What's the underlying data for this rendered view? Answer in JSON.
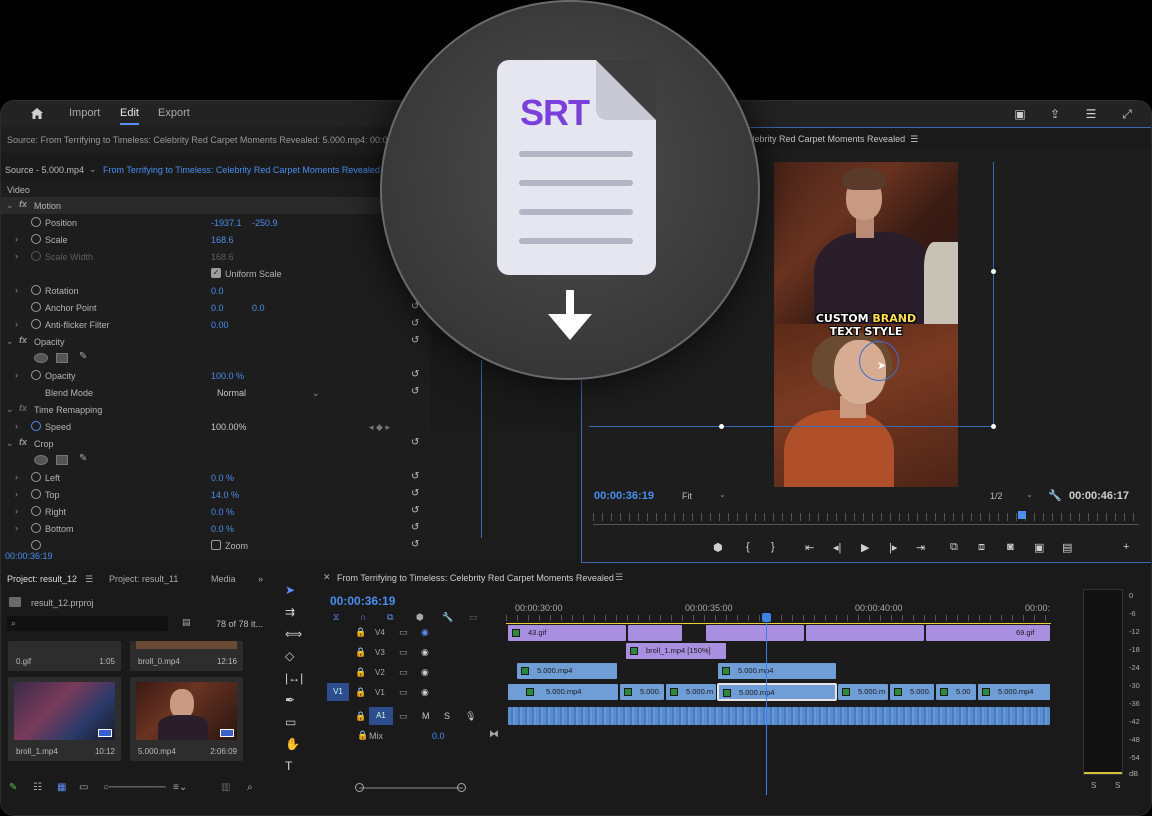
{
  "topbar": {
    "menu": [
      "Import",
      "Edit",
      "Export"
    ],
    "active": "Edit"
  },
  "source": {
    "header": "Source: From Terrifying to Timeless: Celebrity Red Carpet Moments Revealed: 5.000.mp4: 00:00:3",
    "tab_source": "Source - 5.000.mp4",
    "tab_sequence": "From Terrifying to Timeless: Celebrity Red Carpet Moments Revealed -"
  },
  "effect_controls": {
    "section_video": "Video",
    "motion": "Motion",
    "position_label": "Position",
    "position_x": "-1937.1",
    "position_y": "-250.9",
    "scale_label": "Scale",
    "scale_value": "168.6",
    "scale_width_label": "Scale Width",
    "scale_width_value": "168.6",
    "uniform_scale": "Uniform Scale",
    "rotation_label": "Rotation",
    "rotation_value": "0.0",
    "anchor_label": "Anchor Point",
    "anchor_x": "0.0",
    "anchor_y": "0.0",
    "antiflicker_label": "Anti-flicker Filter",
    "antiflicker_value": "0.00",
    "opacity_section": "Opacity",
    "opacity_label": "Opacity",
    "opacity_value": "100.0 %",
    "blend_label": "Blend Mode",
    "blend_value": "Normal",
    "time_remap": "Time Remapping",
    "speed_label": "Speed",
    "speed_value": "100.00%",
    "crop_section": "Crop",
    "left_label": "Left",
    "left_value": "0.0 %",
    "top_label": "Top",
    "top_value": "14.0 %",
    "right_label": "Right",
    "right_value": "0.0 %",
    "bottom_label": "Bottom",
    "bottom_value": "0.0 %",
    "zoom_label": "Zoom",
    "timecode": "00:00:36:19"
  },
  "program": {
    "title": "Celebrity Red Carpet Moments Revealed",
    "caption_line1_a": "CUSTOM ",
    "caption_line1_b": "BRAND",
    "caption_line2": "TEXT STYLE",
    "time_current": "00:00:36:19",
    "fit": "Fit",
    "resolution": "1/2",
    "time_duration": "00:00:46:17"
  },
  "project": {
    "tab_active": "Project: result_12",
    "tab_other": "Project: result_11",
    "tab_media": "Media",
    "file": "result_12.prproj",
    "count": "78 of 78 it...",
    "items": [
      {
        "name": "0.gif",
        "duration": "1:05"
      },
      {
        "name": "broll_0.mp4",
        "duration": "12:16"
      },
      {
        "name": "broll_1.mp4",
        "duration": "10:12"
      },
      {
        "name": "5.000.mp4",
        "duration": "2:06:09"
      }
    ]
  },
  "timeline": {
    "title": "From Terrifying to Timeless: Celebrity Red Carpet Moments Revealed",
    "timecode": "00:00:36:19",
    "ruler": [
      "00:00:30:00",
      "00:00:35:00",
      "00:00:40:00",
      "00:00:"
    ],
    "tracks": [
      "V4",
      "V3",
      "V2",
      "V1",
      "A1"
    ],
    "v1_target": "V1",
    "mix_label": "Mix",
    "mix_value": "0.0",
    "clip_v4_a": "43.gif",
    "clip_v4_b": "69.gif",
    "clip_v3": "broll_1.mp4 [150%]",
    "clip_v2": "5.000.mp4",
    "clip_v1": "5.000.mp4",
    "clip_v1_short": "5.000.",
    "clip_v1_m": "5.000.m",
    "clip_v1_s": "5.00",
    "m_label": "M",
    "s_label": "S"
  },
  "meter": {
    "db": [
      "0",
      "-6",
      "-12",
      "-18",
      "-24",
      "-30",
      "-36",
      "-42",
      "-48",
      "-54",
      "dB"
    ],
    "s_left": "S",
    "s_right": "S"
  },
  "overlay": {
    "label": "SRT"
  }
}
